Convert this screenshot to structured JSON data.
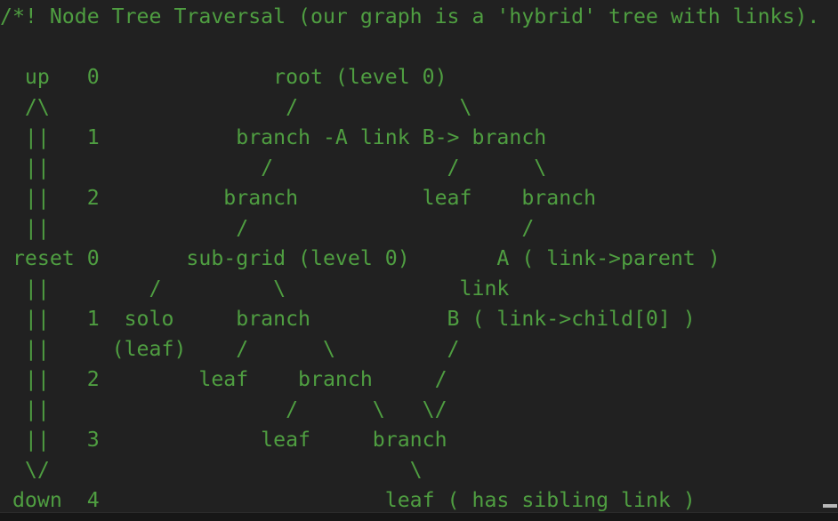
{
  "editor": {
    "background_color": "#212121",
    "text_color": "#4f9e41",
    "font_size_px": 23,
    "line_height_px": 34
  },
  "caret": {
    "visible": true,
    "style": "underscore",
    "color": "#b9b9b9"
  },
  "document": {
    "title": "Node Tree Traversal",
    "comment_open": "/*!",
    "header_text": "/*! Node Tree Traversal (our graph is a 'hybrid' tree with links).",
    "lines": [
      "/*! Node Tree Traversal (our graph is a 'hybrid' tree with links).",
      "",
      "  up   0              root (level 0)",
      "  /\\                   /             \\",
      "  ||   1           branch -A link B-> branch",
      "  ||                 /              /      \\",
      "  ||   2          branch          leaf    branch",
      "  ||               /                      /",
      " reset 0       sub-grid (level 0)       A ( link->parent )",
      "  ||        /         \\              link",
      "  ||   1  solo     branch           B ( link->child[0] )",
      "  ||     (leaf)    /      \\         /",
      "  ||   2        leaf    branch     /",
      "  ||                   /      \\   \\/",
      "  ||   3             leaf     branch",
      "  \\/                             \\",
      " down  4                       leaf ( has sibling link )"
    ],
    "tree_structure": {
      "root_label": "root (level 0)",
      "sub_grid_label": "sub-grid (level 0)",
      "link_label": "link",
      "link_a_label": "A ( link->parent )",
      "link_b_label": "B ( link->child[0] )",
      "sibling_leaf_label": "leaf ( has sibling link )",
      "solo_leaf_label_line1": "solo",
      "solo_leaf_label_line2": "(leaf)",
      "branch_label": "branch",
      "leaf_label": "leaf",
      "link_arrow_left": "-A link B->",
      "node_types": [
        "root",
        "branch",
        "leaf",
        "sub-grid",
        "solo (leaf)",
        "link"
      ]
    },
    "gutter": {
      "up_label": "up",
      "down_label": "down",
      "reset_label": "reset",
      "up_arrow": "/\\",
      "down_arrow": "\\/",
      "rail": "||",
      "upper_levels": [
        "0",
        "1",
        "2"
      ],
      "lower_levels": [
        "0",
        "1",
        "2",
        "3",
        "4"
      ]
    }
  }
}
